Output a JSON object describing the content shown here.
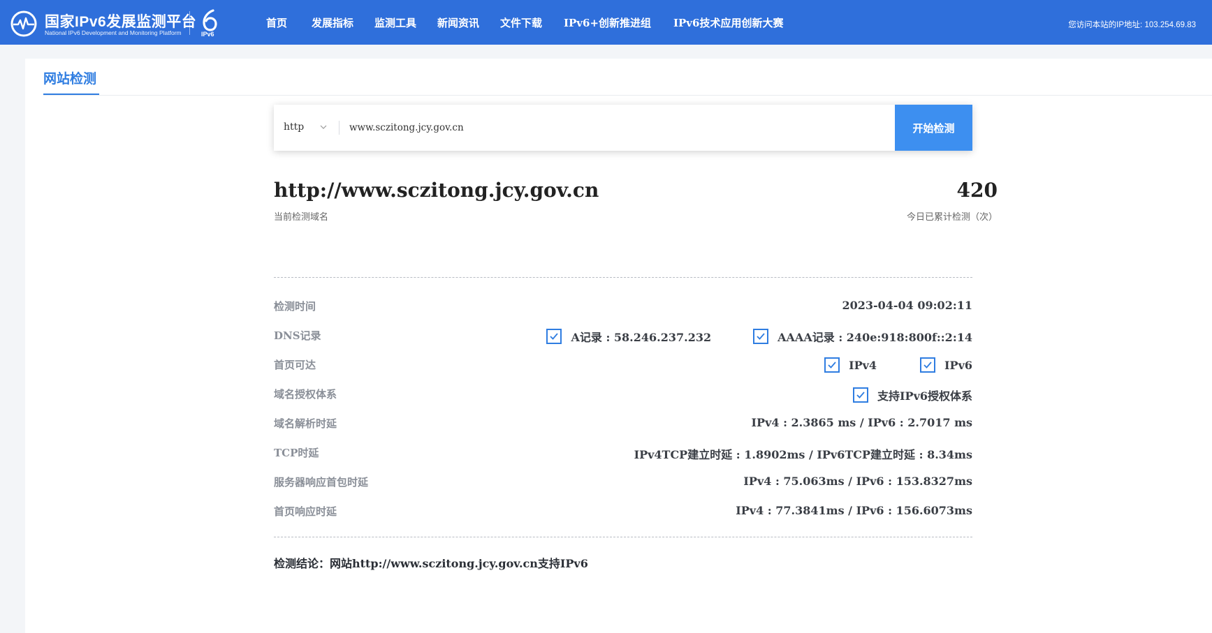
{
  "header": {
    "logo_cn": "国家IPv6发展监测平台",
    "logo_en": "National IPv6 Development and Monitoring Platform",
    "ipv6_badge": "IPv6",
    "nav": [
      "首页",
      "发展指标",
      "监测工具",
      "新闻资讯",
      "文件下载",
      "IPv6+创新推进组",
      "IPv6技术应用创新大赛"
    ],
    "ip_info": "您访问本站的IP地址: 103.254.69.83",
    "accent_color": "#2f6fdb"
  },
  "tab": {
    "title": "网站检测"
  },
  "search": {
    "protocol": "http",
    "url": "www.sczitong.jcy.gov.cn",
    "button": "开始检测"
  },
  "result": {
    "domain": "http://www.sczitong.jcy.gov.cn",
    "domain_caption": "当前检测域名",
    "count": "420",
    "count_caption": "今日已累计检测（次）",
    "rows": {
      "time": {
        "label": "检测时间",
        "value": "2023-04-04 09:02:11"
      },
      "dns": {
        "label": "DNS记录",
        "a": "A记录 : 58.246.237.232",
        "aaaa": "AAAA记录 : 240e:918:800f::2:14"
      },
      "homepage": {
        "label": "首页可达",
        "ipv4": "IPv4",
        "ipv6": "IPv6"
      },
      "authority": {
        "label": "域名授权体系",
        "value": "支持IPv6授权体系"
      },
      "resolve": {
        "label": "域名解析时延",
        "value": "IPv4 : 2.3865 ms / IPv6 : 2.7017 ms"
      },
      "tcp": {
        "label": "TCP时延",
        "value": "IPv4TCP建立时延 : 1.8902ms / IPv6TCP建立时延 : 8.34ms"
      },
      "first_packet": {
        "label": "服务器响应首包时延",
        "value": "IPv4 : 75.063ms / IPv6 : 153.8327ms"
      },
      "homepage_latency": {
        "label": "首页响应时延",
        "value": "IPv4 : 77.3841ms / IPv6 : 156.6073ms"
      }
    },
    "conclusion": "检测结论：网站http://www.sczitong.jcy.gov.cn支持IPv6"
  }
}
